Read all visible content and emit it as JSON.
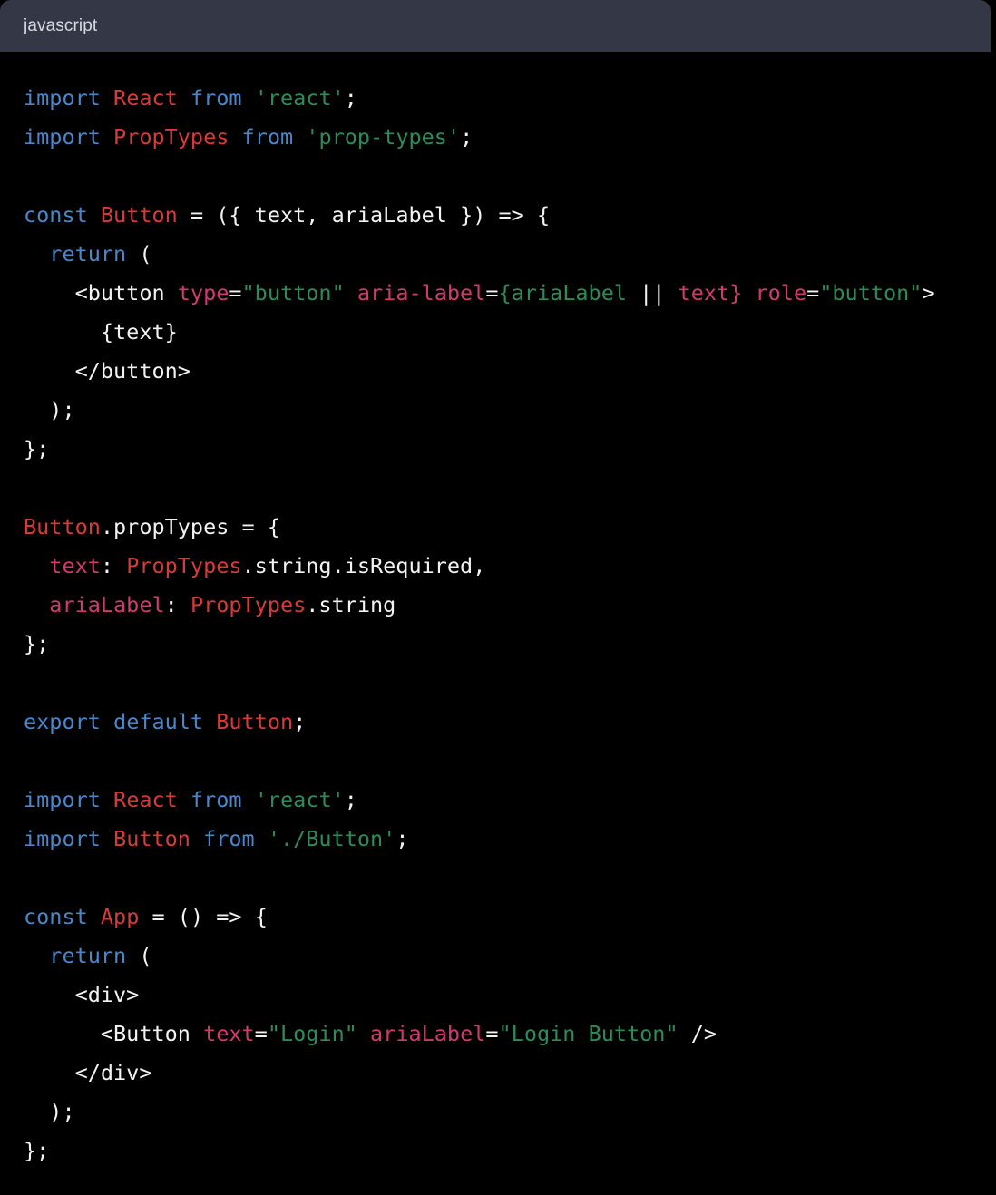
{
  "header": {
    "language_label": "javascript"
  },
  "theme": {
    "header_bg": "#343746",
    "header_text": "#d8dae3",
    "body_bg": "#000000",
    "plain": "#f2f2f2",
    "keyword": "#4a86c8",
    "class_name": "#d83a3a",
    "string": "#2e8b57",
    "attribute": "#d13a6f"
  },
  "code": {
    "lines": [
      [
        {
          "t": "import",
          "c": "kw"
        },
        {
          "t": " ",
          "c": "pln"
        },
        {
          "t": "React",
          "c": "cls"
        },
        {
          "t": " ",
          "c": "pln"
        },
        {
          "t": "from",
          "c": "kw"
        },
        {
          "t": " ",
          "c": "pln"
        },
        {
          "t": "'react'",
          "c": "str"
        },
        {
          "t": ";",
          "c": "pln"
        }
      ],
      [
        {
          "t": "import",
          "c": "kw"
        },
        {
          "t": " ",
          "c": "pln"
        },
        {
          "t": "PropTypes",
          "c": "cls"
        },
        {
          "t": " ",
          "c": "pln"
        },
        {
          "t": "from",
          "c": "kw"
        },
        {
          "t": " ",
          "c": "pln"
        },
        {
          "t": "'prop-types'",
          "c": "str"
        },
        {
          "t": ";",
          "c": "pln"
        }
      ],
      [],
      [
        {
          "t": "const",
          "c": "kw"
        },
        {
          "t": " ",
          "c": "pln"
        },
        {
          "t": "Button",
          "c": "cls"
        },
        {
          "t": " = ({ text, ariaLabel }) => {",
          "c": "pln"
        }
      ],
      [
        {
          "t": "  ",
          "c": "pln"
        },
        {
          "t": "return",
          "c": "kw"
        },
        {
          "t": " (",
          "c": "pln"
        }
      ],
      [
        {
          "t": "    <button ",
          "c": "pln"
        },
        {
          "t": "type",
          "c": "attr"
        },
        {
          "t": "=",
          "c": "pln"
        },
        {
          "t": "\"button\"",
          "c": "str"
        },
        {
          "t": " ",
          "c": "pln"
        },
        {
          "t": "aria-label",
          "c": "attr"
        },
        {
          "t": "=",
          "c": "pln"
        },
        {
          "t": "{ariaLabel",
          "c": "str"
        },
        {
          "t": " || ",
          "c": "pln"
        },
        {
          "t": "text}",
          "c": "attr"
        },
        {
          "t": " ",
          "c": "pln"
        },
        {
          "t": "role",
          "c": "attr"
        },
        {
          "t": "=",
          "c": "pln"
        },
        {
          "t": "\"button\"",
          "c": "str"
        },
        {
          "t": ">",
          "c": "pln"
        }
      ],
      [
        {
          "t": "      {text}",
          "c": "pln"
        }
      ],
      [
        {
          "t": "    </button>",
          "c": "pln"
        }
      ],
      [
        {
          "t": "  );",
          "c": "pln"
        }
      ],
      [
        {
          "t": "};",
          "c": "pln"
        }
      ],
      [],
      [
        {
          "t": "Button",
          "c": "cls"
        },
        {
          "t": ".propTypes = {",
          "c": "pln"
        }
      ],
      [
        {
          "t": "  ",
          "c": "pln"
        },
        {
          "t": "text",
          "c": "attr"
        },
        {
          "t": ": ",
          "c": "pln"
        },
        {
          "t": "PropTypes",
          "c": "cls"
        },
        {
          "t": ".string.isRequired,",
          "c": "pln"
        }
      ],
      [
        {
          "t": "  ",
          "c": "pln"
        },
        {
          "t": "ariaLabel",
          "c": "attr"
        },
        {
          "t": ": ",
          "c": "pln"
        },
        {
          "t": "PropTypes",
          "c": "cls"
        },
        {
          "t": ".string",
          "c": "pln"
        }
      ],
      [
        {
          "t": "};",
          "c": "pln"
        }
      ],
      [],
      [
        {
          "t": "export",
          "c": "kw"
        },
        {
          "t": " ",
          "c": "pln"
        },
        {
          "t": "default",
          "c": "kw"
        },
        {
          "t": " ",
          "c": "pln"
        },
        {
          "t": "Button",
          "c": "cls"
        },
        {
          "t": ";",
          "c": "pln"
        }
      ],
      [],
      [
        {
          "t": "import",
          "c": "kw"
        },
        {
          "t": " ",
          "c": "pln"
        },
        {
          "t": "React",
          "c": "cls"
        },
        {
          "t": " ",
          "c": "pln"
        },
        {
          "t": "from",
          "c": "kw"
        },
        {
          "t": " ",
          "c": "pln"
        },
        {
          "t": "'react'",
          "c": "str"
        },
        {
          "t": ";",
          "c": "pln"
        }
      ],
      [
        {
          "t": "import",
          "c": "kw"
        },
        {
          "t": " ",
          "c": "pln"
        },
        {
          "t": "Button",
          "c": "cls"
        },
        {
          "t": " ",
          "c": "pln"
        },
        {
          "t": "from",
          "c": "kw"
        },
        {
          "t": " ",
          "c": "pln"
        },
        {
          "t": "'./Button'",
          "c": "str"
        },
        {
          "t": ";",
          "c": "pln"
        }
      ],
      [],
      [
        {
          "t": "const",
          "c": "kw"
        },
        {
          "t": " ",
          "c": "pln"
        },
        {
          "t": "App",
          "c": "cls"
        },
        {
          "t": " = () => {",
          "c": "pln"
        }
      ],
      [
        {
          "t": "  ",
          "c": "pln"
        },
        {
          "t": "return",
          "c": "kw"
        },
        {
          "t": " (",
          "c": "pln"
        }
      ],
      [
        {
          "t": "    <div>",
          "c": "pln"
        }
      ],
      [
        {
          "t": "      <Button ",
          "c": "pln"
        },
        {
          "t": "text",
          "c": "attr"
        },
        {
          "t": "=",
          "c": "pln"
        },
        {
          "t": "\"Login\"",
          "c": "str"
        },
        {
          "t": " ",
          "c": "pln"
        },
        {
          "t": "ariaLabel",
          "c": "attr"
        },
        {
          "t": "=",
          "c": "pln"
        },
        {
          "t": "\"Login Button\"",
          "c": "str"
        },
        {
          "t": " />",
          "c": "pln"
        }
      ],
      [
        {
          "t": "    </div>",
          "c": "pln"
        }
      ],
      [
        {
          "t": "  );",
          "c": "pln"
        }
      ],
      [
        {
          "t": "};",
          "c": "pln"
        }
      ]
    ]
  }
}
